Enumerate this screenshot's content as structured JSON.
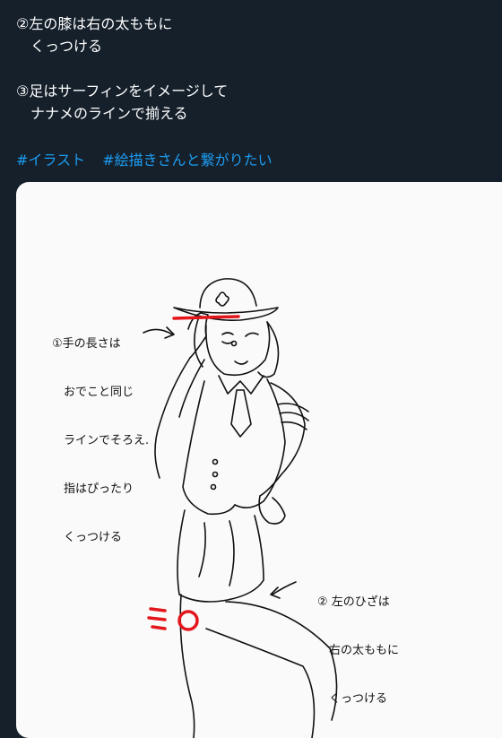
{
  "tweet": {
    "lines": [
      "②左の膝は右の太ももに",
      "　くっつける",
      "",
      "③足はサーフィンをイメージして",
      "　ナナメのラインで揃える"
    ],
    "hashtags": [
      "#イラスト",
      "#絵描きさんと繋がりたい"
    ]
  },
  "media": {
    "annotation_1": [
      "①手の長さは",
      "　おでこと同じ",
      "　ラインでそろえ.",
      "　指はぴったり",
      "　くっつける"
    ],
    "annotation_2": [
      "② 左のひざは",
      "　右の太ももに",
      "　くっつける"
    ]
  },
  "colors": {
    "background": "#15202b",
    "link": "#1d9bf0",
    "paper": "#fafafa",
    "ink": "#111111",
    "accent_red": "#e3161c"
  }
}
